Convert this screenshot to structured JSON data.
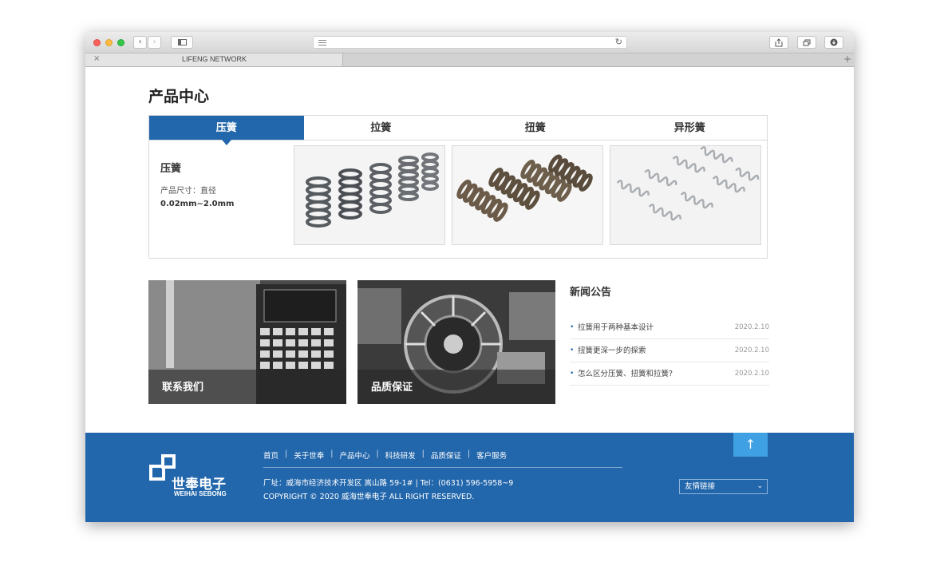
{
  "browser": {
    "tab_title": "LIFENG NETWORK",
    "tab_close": "×",
    "new_tab": "+",
    "back": "‹",
    "forward": "›",
    "reload": "↻"
  },
  "products": {
    "section_title": "产品中心",
    "tabs": [
      {
        "label": "压簧"
      },
      {
        "label": "拉簧"
      },
      {
        "label": "扭簧"
      },
      {
        "label": "异形簧"
      }
    ],
    "active": {
      "name": "压簧",
      "spec_label": "产品尺寸：直径",
      "spec_value": "0.02mm~2.0mm"
    },
    "images": [
      "dark-compression-springs",
      "bronze-compression-springs",
      "silver-small-springs"
    ]
  },
  "cards": [
    {
      "label": "联系我们"
    },
    {
      "label": "品质保证"
    }
  ],
  "news": {
    "title": "新闻公告",
    "items": [
      {
        "title": "拉簧用于两种基本设计",
        "date": "2020.2.10"
      },
      {
        "title": "扭簧更深一步的探索",
        "date": "2020.2.10"
      },
      {
        "title": "怎么区分压簧、扭簧和拉簧?",
        "date": "2020.2.10"
      }
    ]
  },
  "footer": {
    "logo_cn": "世奉电子",
    "logo_en": "WEIHAI SEBONG",
    "nav": [
      "首页",
      "关于世奉",
      "产品中心",
      "科技研发",
      "品质保证",
      "客户服务"
    ],
    "address": "厂址：威海市经济技术开发区 嵩山路 59-1#  |  Tel：(0631) 596-5958~9",
    "copyright": "COPYRIGHT © 2020 威海世奉电子 ALL RIGHT RESERVED.",
    "links_label": "友情链接",
    "to_top": "↑"
  },
  "colors": {
    "brand_blue": "#2266ab",
    "to_top_blue": "#3fa1e3"
  }
}
